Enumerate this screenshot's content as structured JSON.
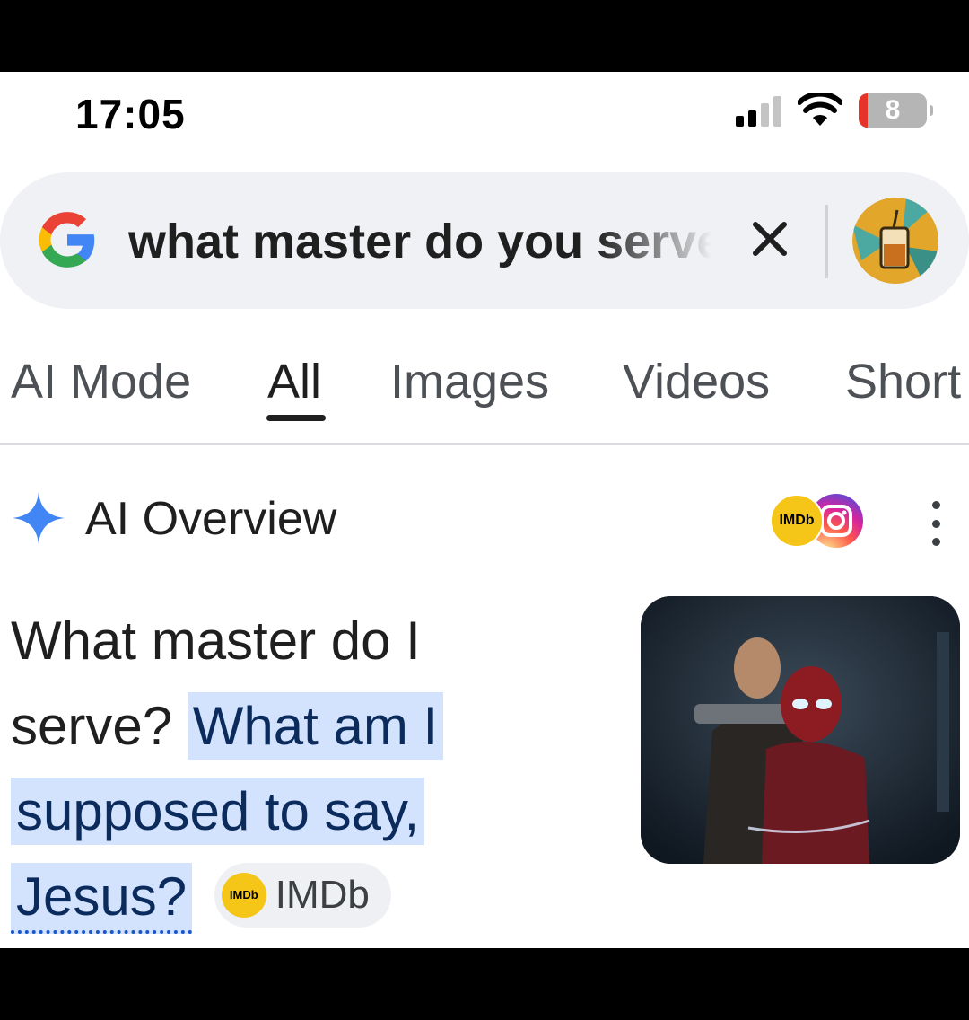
{
  "status_bar": {
    "time": "17:05",
    "battery_level": "8",
    "battery_fraction": 0.08,
    "icons": [
      "cellular-signal-icon",
      "wifi-icon",
      "battery-icon"
    ]
  },
  "search": {
    "query": "what master do you serve",
    "logo": "google-g-icon",
    "clear_icon": "close-icon",
    "avatar": "user-avatar"
  },
  "tabs": [
    {
      "label": "AI Mode",
      "active": false
    },
    {
      "label": "All",
      "active": true
    },
    {
      "label": "Images",
      "active": false
    },
    {
      "label": "Videos",
      "active": false
    },
    {
      "label": "Short",
      "active": false
    }
  ],
  "ai_overview": {
    "title": "AI Overview",
    "source_badges": [
      "IMDb",
      "instagram-icon"
    ],
    "imdb_badge_text": "IMDb",
    "answer_plain": "What master do I serve?",
    "answer_highlight_1": "What am I",
    "answer_highlight_2": "supposed to say,",
    "answer_highlight_3": "Jesus?",
    "source_chip": {
      "logo_text": "IMDb",
      "label": "IMDb"
    }
  },
  "colors": {
    "highlight_bg": "#d3e3fd",
    "ai_spark": "#4285f4",
    "search_bg": "#eff1f4",
    "imdb_yellow": "#f5c518"
  }
}
